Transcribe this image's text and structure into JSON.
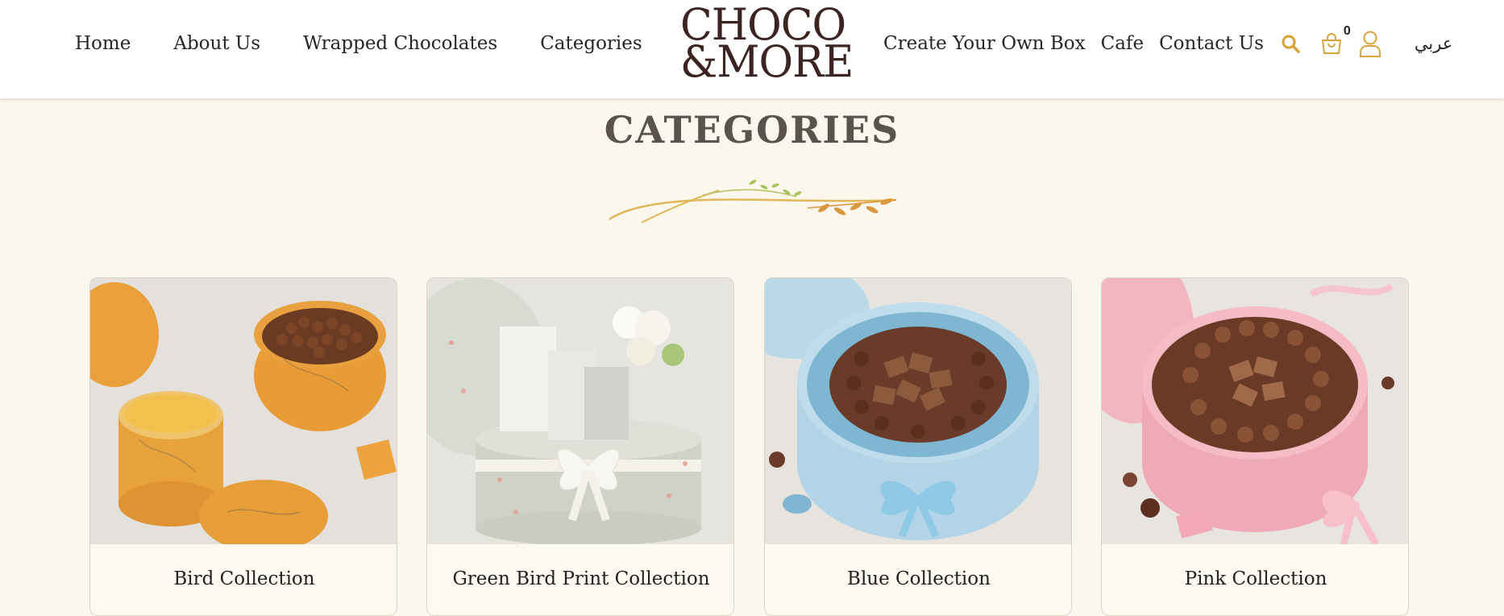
{
  "nav": {
    "left": [
      "Home",
      "About Us",
      "Wrapped Chocolates",
      "Categories"
    ],
    "right": [
      "Create Your Own Box",
      "Cafe",
      "Contact Us"
    ],
    "cart_count": "0",
    "language": "عربي"
  },
  "logo": {
    "line1": "CHOCO",
    "line2": "&MORE"
  },
  "page": {
    "title": "CATEGORIES"
  },
  "categories": [
    {
      "title": "Bird Collection"
    },
    {
      "title": "Green Bird Print Collection"
    },
    {
      "title": "Blue Collection"
    },
    {
      "title": "Pink Collection"
    }
  ],
  "colors": {
    "accent": "#d9a43f",
    "background": "#fbf7ec",
    "logo": "#3b2422"
  }
}
